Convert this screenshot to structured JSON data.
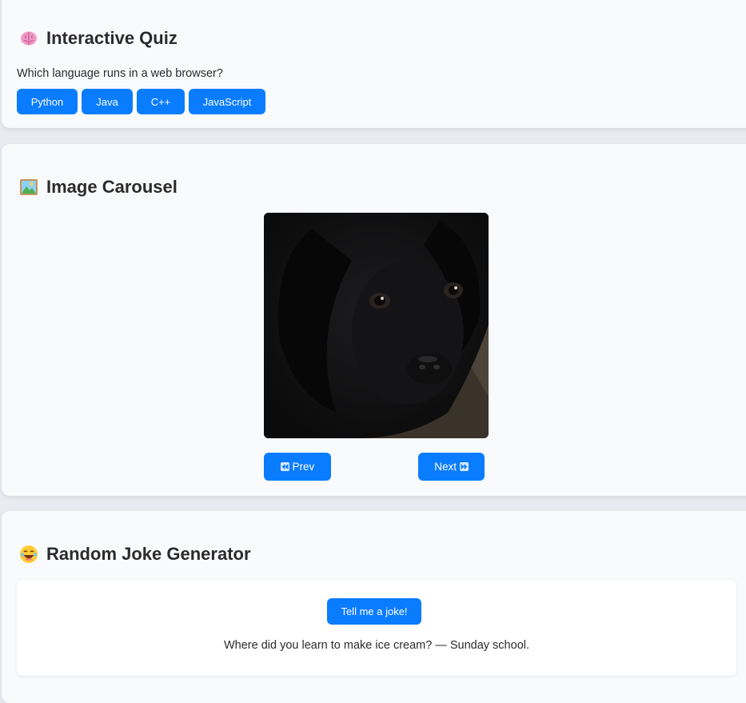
{
  "quiz": {
    "title": "Interactive Quiz",
    "question": "Which language runs in a web browser?",
    "options": [
      "Python",
      "Java",
      "C++",
      "JavaScript"
    ]
  },
  "carousel": {
    "title": "Image Carousel",
    "prev_label": "Prev",
    "next_label": "Next"
  },
  "joke": {
    "title": "Random Joke Generator",
    "button_label": "Tell me a joke!",
    "text": "Where did you learn to make ice cream? — Sunday school."
  },
  "colors": {
    "accent": "#0a7cff",
    "card_bg": "#f9fafc",
    "page_bg": "#e8ebf0"
  },
  "icons": {
    "quiz": "brain-icon",
    "carousel": "framed-picture-icon",
    "joke": "laughing-face-icon",
    "prev": "rewind-icon",
    "next": "fast-forward-icon"
  }
}
